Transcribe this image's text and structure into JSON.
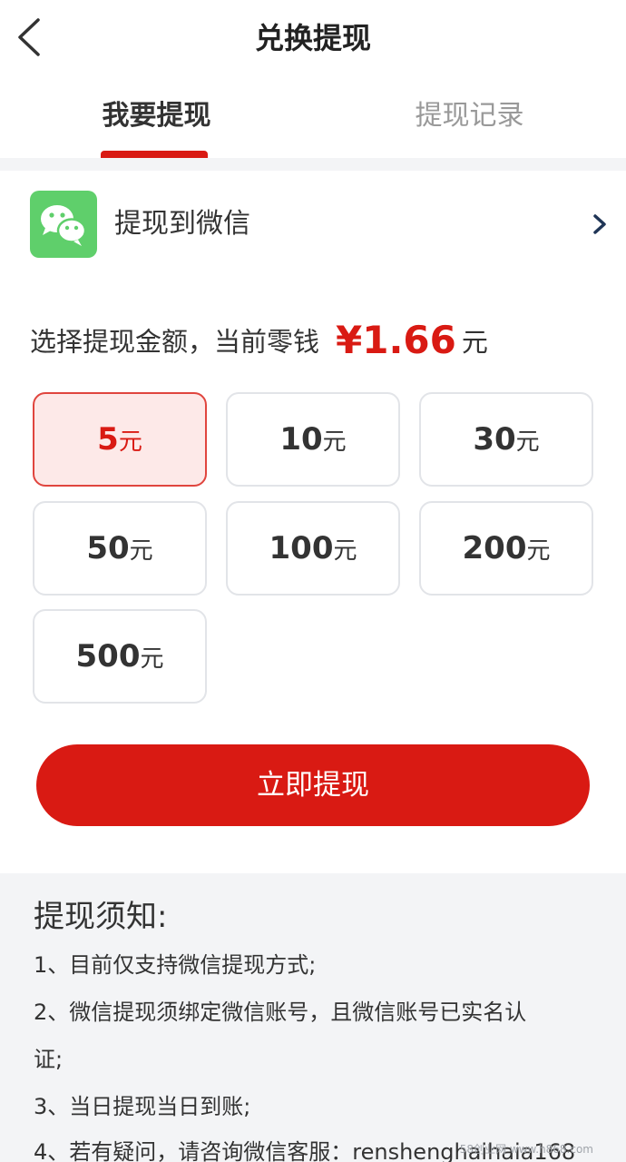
{
  "header": {
    "title": "兑换提现"
  },
  "tabs": [
    {
      "label": "我要提现",
      "active": true
    },
    {
      "label": "提现记录",
      "active": false
    }
  ],
  "method": {
    "label": "提现到微信",
    "icon": "wechat-icon"
  },
  "amount_prompt": {
    "text": "选择提现金额，当前零钱",
    "balance": "¥1.66",
    "unit": "元"
  },
  "amounts": [
    {
      "value": "5",
      "unit": "元",
      "selected": true
    },
    {
      "value": "10",
      "unit": "元",
      "selected": false
    },
    {
      "value": "30",
      "unit": "元",
      "selected": false
    },
    {
      "value": "50",
      "unit": "元",
      "selected": false
    },
    {
      "value": "100",
      "unit": "元",
      "selected": false
    },
    {
      "value": "200",
      "unit": "元",
      "selected": false
    },
    {
      "value": "500",
      "unit": "元",
      "selected": false
    }
  ],
  "submit": {
    "label": "立即提现"
  },
  "notice": {
    "title": "提现须知:",
    "lines": [
      "1、目前仅支持微信提现方式;",
      "2、微信提现须绑定微信账号，且微信账号已实名认",
      "证;",
      "3、当日提现当日到账;",
      "4、若有疑问，请咨询微信客服：renshenghaihaia168"
    ]
  },
  "watermark": "58创业网 www.h868.com",
  "colors": {
    "accent": "#d91a13",
    "selected_bg": "#fde9e8",
    "wechat": "#5fcf6b",
    "notice_bg": "#f3f4f6"
  }
}
